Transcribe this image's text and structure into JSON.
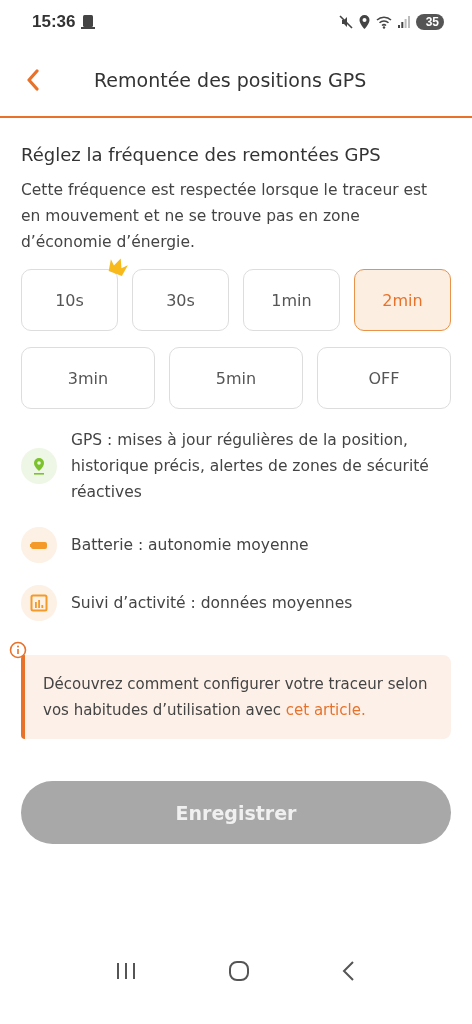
{
  "status_bar": {
    "time": "15:36",
    "battery": "35"
  },
  "header": {
    "title": "Remontée des positions GPS"
  },
  "section_title": "Réglez la fréquence des remontées GPS",
  "description": "Cette fréquence est respectée lorsque le traceur est en mouvement et ne se trouve pas en zone d’économie d’énergie.",
  "options": [
    {
      "label": "10s",
      "selected": false,
      "premium": true
    },
    {
      "label": "30s",
      "selected": false,
      "premium": false
    },
    {
      "label": "1min",
      "selected": false,
      "premium": false
    },
    {
      "label": "2min",
      "selected": true,
      "premium": false
    },
    {
      "label": "3min",
      "selected": false,
      "premium": false
    },
    {
      "label": "5min",
      "selected": false,
      "premium": false
    },
    {
      "label": "OFF",
      "selected": false,
      "premium": false
    }
  ],
  "features": [
    {
      "kind": "gps",
      "text": "GPS : mises à jour régulières de la position, historique précis, alertes de zones de sécurité réactives"
    },
    {
      "kind": "battery",
      "text": "Batterie : autonomie moyenne"
    },
    {
      "kind": "activity",
      "text": "Suivi d’activité : données moyennes"
    }
  ],
  "info": {
    "text": "Découvrez comment configurer votre traceur selon vos habitudes d’utilisation avec",
    "link": "cet article."
  },
  "save_button": {
    "label": "Enregistrer",
    "disabled": true
  }
}
